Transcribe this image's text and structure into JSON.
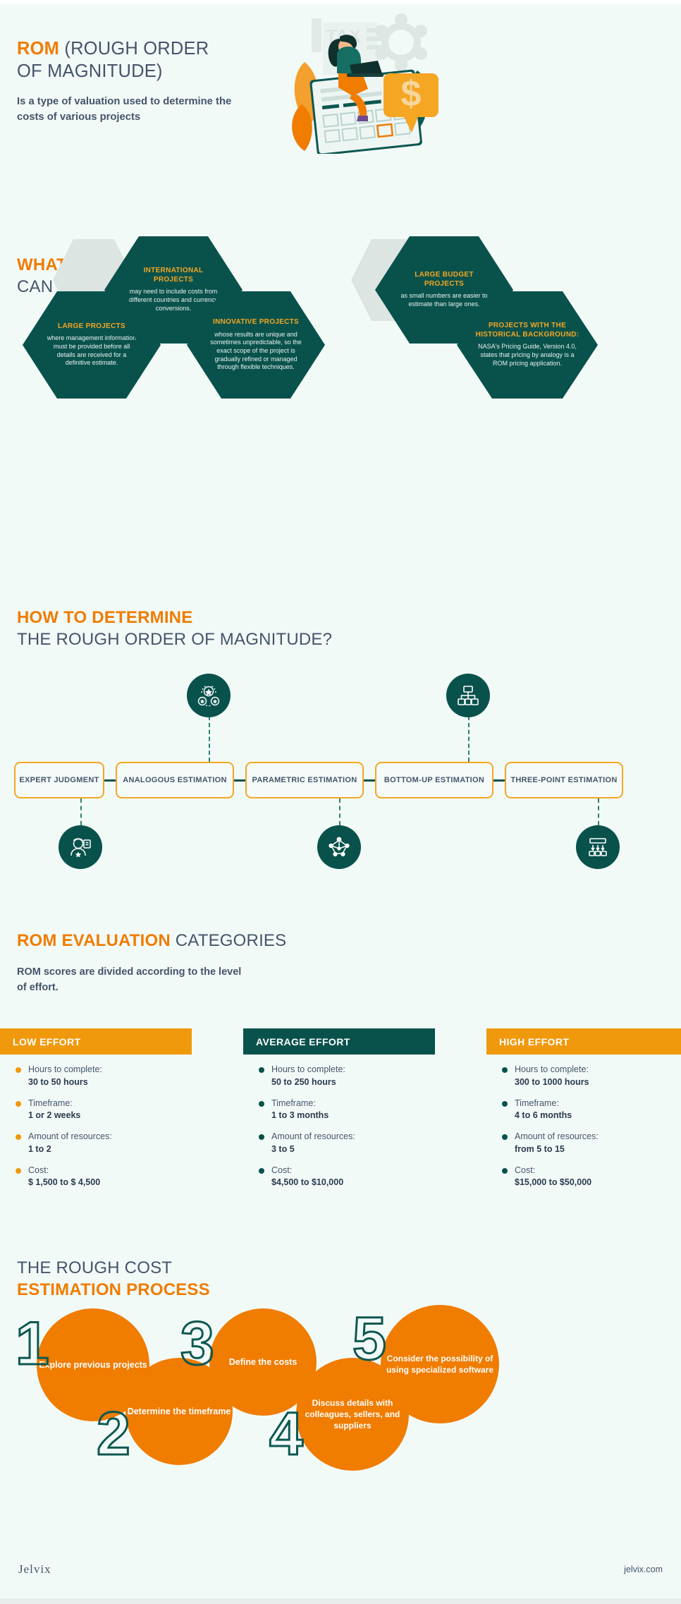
{
  "colors": {
    "orange": "#f07c00",
    "amber": "#f5a623",
    "teal": "#09524c",
    "slate": "#46546a",
    "background": "#f2faf8",
    "ghost_hex": "#dde5e2"
  },
  "hero": {
    "title_accent": "ROM",
    "title_rest": " (ROUGH ORDER",
    "title_line2": "OF MAGNITUDE)",
    "subtitle": "Is a type of valuation used to determine the costs of various projects",
    "art_label": "TAX",
    "art_currency": "$"
  },
  "section_projects": {
    "heading_accent": "WHAT PROJECTS",
    "heading_rest": "CAN YOU USE ROM FOR?",
    "hexagons": [
      {
        "title": "LARGE PROJECTS",
        "body": "where management information must be provided before all details are received for a definitive estimate."
      },
      {
        "title": "INTERNATIONAL PROJECTS",
        "body": "may need to include costs from different countries and currency conversions."
      },
      {
        "title": "INNOVATIVE PROJECTS",
        "body": "whose results are unique and sometimes unpredictable, so the exact scope of the project is gradually refined or managed through flexible techniques."
      },
      {
        "title": "LARGE BUDGET PROJECTS",
        "body": "as small numbers are easier to estimate than large ones."
      },
      {
        "title": "PROJECTS WITH THE HISTORICAL BACKGROUND:",
        "body": "NASA's Pricing Guide, Version 4.0, states that pricing by analogy is a ROM pricing application."
      }
    ]
  },
  "section_determine": {
    "heading_accent": "HOW TO DETERMINE",
    "heading_rest": "THE ROUGH ORDER OF MAGNITUDE?",
    "methods": [
      {
        "label": "EXPERT JUDGMENT",
        "icon": "expert-judgment-icon"
      },
      {
        "label": "ANALOGOUS ESTIMATION",
        "icon": "analogous-estimation-icon"
      },
      {
        "label": "PARAMETRIC ESTIMATION",
        "icon": "parametric-estimation-icon"
      },
      {
        "label": "BOTTOM-UP ESTIMATION",
        "icon": "bottom-up-estimation-icon"
      },
      {
        "label": "THREE-POINT ESTIMATION",
        "icon": "three-point-estimation-icon"
      }
    ]
  },
  "section_evaluation": {
    "heading_accent": "ROM EVALUATION",
    "heading_rest": " CATEGORIES",
    "subtitle": "ROM scores are divided according to the level of effort.",
    "columns": [
      {
        "title": "LOW EFFORT",
        "header_bg": "#f0990d",
        "bullet_color": "#f0990d",
        "items": [
          {
            "label": "Hours to complete:",
            "value": "30 to 50 hours"
          },
          {
            "label": "Timeframe:",
            "value": "1 or 2 weeks"
          },
          {
            "label": "Amount of resources:",
            "value": "1 to 2"
          },
          {
            "label": "Cost:",
            "value": "$ 1,500 to $ 4,500"
          }
        ]
      },
      {
        "title": "AVERAGE EFFORT",
        "header_bg": "#09524c",
        "bullet_color": "#09524c",
        "items": [
          {
            "label": "Hours to complete:",
            "value": "50 to 250 hours"
          },
          {
            "label": "Timeframe:",
            "value": " 1 to 3 months"
          },
          {
            "label": "Amount of resources:",
            "value": "3 to 5"
          },
          {
            "label": "Cost:",
            "value": "$4,500 to $10,000"
          }
        ]
      },
      {
        "title": "HIGH EFFORT",
        "header_bg": "#f0990d",
        "bullet_color": "#09524c",
        "items": [
          {
            "label": "Hours to complete:",
            "value": "300 to 1000 hours"
          },
          {
            "label": "Timeframe:",
            "value": " 4 to 6 months"
          },
          {
            "label": "Amount of resources:",
            "value": "from 5 to 15"
          },
          {
            "label": "Cost:",
            "value": "$15,000 to $50,000"
          }
        ]
      }
    ]
  },
  "section_process": {
    "heading_line1": "THE ROUGH COST",
    "heading_line2": "ESTIMATION PROCESS",
    "steps": [
      {
        "number": "1",
        "text": "Explore previous projects"
      },
      {
        "number": "2",
        "text": "Determine the timeframe"
      },
      {
        "number": "3",
        "text": "Define the costs"
      },
      {
        "number": "4",
        "text": "Discuss details with colleagues, sellers, and suppliers"
      },
      {
        "number": "5",
        "text": "Consider the possibility of using specialized software"
      }
    ]
  },
  "footer": {
    "logo": "Jelvix",
    "url": "jelvix.com"
  }
}
